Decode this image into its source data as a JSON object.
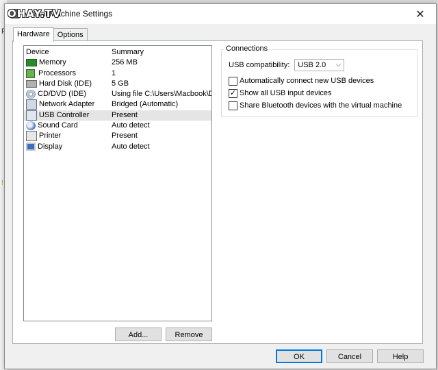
{
  "window": {
    "title": "Virtual Machine Settings",
    "watermark": "OHAY.TV",
    "close_glyph": "✕"
  },
  "background": {
    "left_letter": "P",
    "left_letter2": "!"
  },
  "tabs": [
    {
      "label": "Hardware",
      "active": true
    },
    {
      "label": "Options",
      "active": false
    }
  ],
  "device_list": {
    "header_device": "Device",
    "header_summary": "Summary",
    "rows": [
      {
        "device": "Memory",
        "summary": "256 MB",
        "icon": "memory-icon"
      },
      {
        "device": "Processors",
        "summary": "1",
        "icon": "processor-icon"
      },
      {
        "device": "Hard Disk (IDE)",
        "summary": "5 GB",
        "icon": "hard-disk-icon"
      },
      {
        "device": "CD/DVD (IDE)",
        "summary": "Using file C:\\Users\\Macbook\\D...",
        "icon": "cd-dvd-icon"
      },
      {
        "device": "Network Adapter",
        "summary": "Bridged (Automatic)",
        "icon": "network-adapter-icon"
      },
      {
        "device": "USB Controller",
        "summary": "Present",
        "icon": "usb-controller-icon",
        "selected": true
      },
      {
        "device": "Sound Card",
        "summary": "Auto detect",
        "icon": "sound-card-icon"
      },
      {
        "device": "Printer",
        "summary": "Present",
        "icon": "printer-icon"
      },
      {
        "device": "Display",
        "summary": "Auto detect",
        "icon": "display-icon"
      }
    ]
  },
  "list_buttons": {
    "add": "Add...",
    "remove": "Remove"
  },
  "connections": {
    "label": "Connections",
    "usb_compat_label": "USB compatibility:",
    "usb_compat_value": "USB 2.0",
    "checkboxes": [
      {
        "label": "Automatically connect new USB devices",
        "checked": false
      },
      {
        "label": "Show all USB input devices",
        "checked": true
      },
      {
        "label": "Share Bluetooth devices with the virtual machine",
        "checked": false
      }
    ]
  },
  "footer": {
    "ok": "OK",
    "cancel": "Cancel",
    "help": "Help"
  },
  "colors": {
    "accent": "#0078d7",
    "selected_row": "#e5e5e5"
  }
}
